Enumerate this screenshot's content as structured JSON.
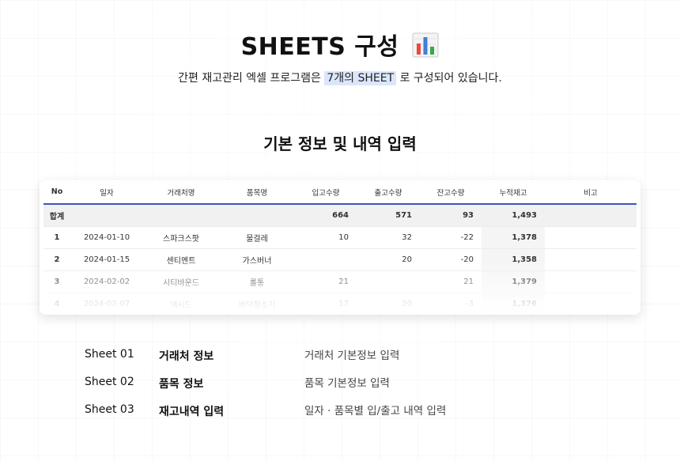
{
  "header": {
    "title": "SHEETS 구성",
    "title_icon": "bar-chart-icon",
    "subtitle_before": "간편 재고관리 엑셀 프로그램은 ",
    "subtitle_highlight": "7개의 SHEET",
    "subtitle_after": " 로 구성되어 있습니다."
  },
  "section": {
    "title": "기본 정보 및 내역 입력"
  },
  "table": {
    "columns": [
      "No",
      "일자",
      "거래처명",
      "품목명",
      "입고수량",
      "출고수량",
      "잔고수량",
      "누적재고",
      "비고"
    ],
    "total": {
      "label": "합계",
      "in": "664",
      "out": "571",
      "balance": "93",
      "cumulative": "1,493"
    },
    "rows": [
      {
        "no": "1",
        "date": "2024-01-10",
        "vendor": "스파크스팟",
        "item": "물걸레",
        "in": "10",
        "out": "32",
        "balance": "-22",
        "cumulative": "1,378",
        "note": ""
      },
      {
        "no": "2",
        "date": "2024-01-15",
        "vendor": "센티멘트",
        "item": "가스버너",
        "in": "",
        "out": "20",
        "balance": "-20",
        "cumulative": "1,358",
        "note": ""
      },
      {
        "no": "3",
        "date": "2024-02-02",
        "vendor": "시티바운드",
        "item": "롤통",
        "in": "21",
        "out": "",
        "balance": "21",
        "cumulative": "1,379",
        "note": ""
      },
      {
        "no": "4",
        "date": "2024-02-07",
        "vendor": "넥시드",
        "item": "바닥청소기",
        "in": "17",
        "out": "20",
        "balance": "-3",
        "cumulative": "1,376",
        "note": ""
      }
    ]
  },
  "sheets": [
    {
      "num": "Sheet 01",
      "name": "거래처 정보",
      "desc": "거래처 기본정보 입력"
    },
    {
      "num": "Sheet 02",
      "name": "품목 정보",
      "desc": "품목 기본정보 입력"
    },
    {
      "num": "Sheet 03",
      "name": "재고내역 입력",
      "desc": "일자 · 품목별 입/출고 내역 입력"
    }
  ],
  "colors": {
    "accent": "#3c55b8",
    "highlight": "#dbe6fb"
  }
}
